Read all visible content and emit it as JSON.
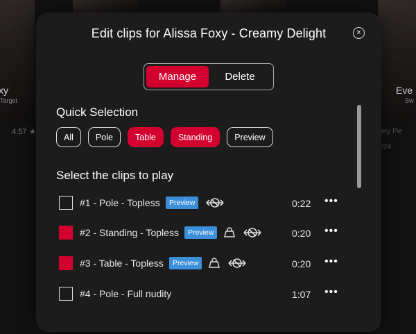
{
  "background": {
    "left_card": {
      "name": "xy",
      "sub": "Target",
      "rating": "4.57"
    },
    "right_card": {
      "name": "Eve",
      "sub": "Sw",
      "meta1": "ety Pie",
      "meta2": "/24"
    }
  },
  "modal": {
    "title": "Edit clips for Alissa Foxy - Creamy Delight",
    "close_icon": "×",
    "tabs": [
      {
        "label": "Manage",
        "active": true
      },
      {
        "label": "Delete",
        "active": false
      }
    ],
    "quick_selection": {
      "title": "Quick Selection",
      "chips": [
        {
          "label": "All",
          "selected": false
        },
        {
          "label": "Pole",
          "selected": false
        },
        {
          "label": "Table",
          "selected": true
        },
        {
          "label": "Standing",
          "selected": true
        },
        {
          "label": "Preview",
          "selected": false
        }
      ]
    },
    "clips_section": {
      "title": "Select the clips to play",
      "clips": [
        {
          "label": "#1 - Pole - Topless",
          "duration": "0:22",
          "checked": false,
          "preview_badge": "Preview",
          "has_bag_icon": false,
          "has_nosync_icon": true,
          "more": "•••"
        },
        {
          "label": "#2 - Standing - Topless",
          "duration": "0:20",
          "checked": true,
          "preview_badge": "Preview",
          "has_bag_icon": true,
          "has_nosync_icon": true,
          "more": "•••"
        },
        {
          "label": "#3 - Table - Topless",
          "duration": "0:20",
          "checked": true,
          "preview_badge": "Preview",
          "has_bag_icon": true,
          "has_nosync_icon": true,
          "more": "•••"
        },
        {
          "label": "#4 - Pole - Full nudity",
          "duration": "1:07",
          "checked": false,
          "preview_badge": "",
          "has_bag_icon": false,
          "has_nosync_icon": false,
          "more": "•••"
        }
      ]
    },
    "colors": {
      "accent": "#d3002f",
      "preview_badge": "#3b8fdb",
      "modal_bg": "#1c1c1c"
    }
  }
}
